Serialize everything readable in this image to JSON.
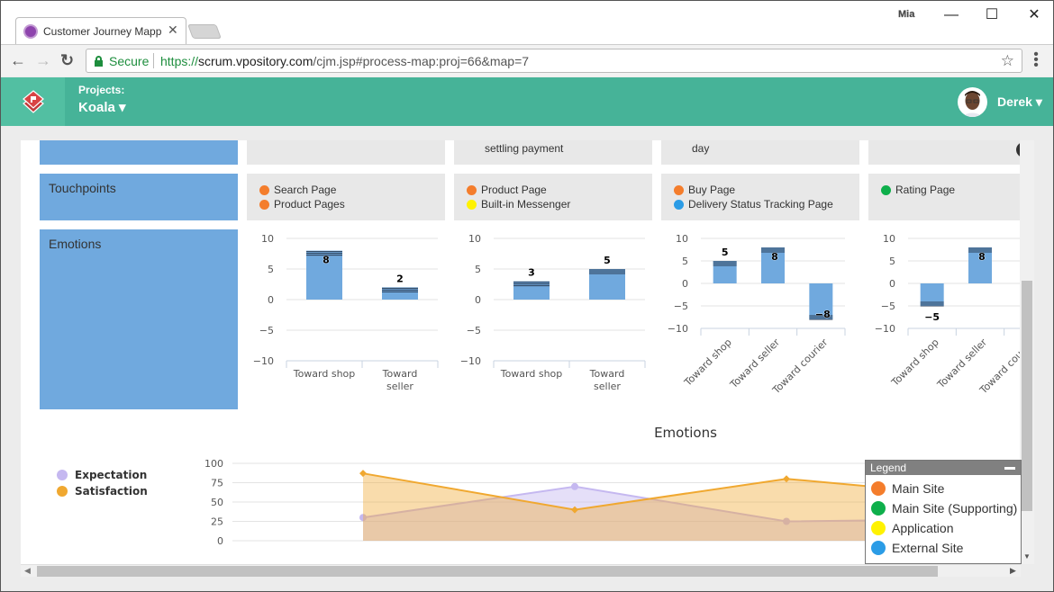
{
  "browser": {
    "tab_title": "Customer Journey Mappi",
    "profile": "Mia",
    "secure_label": "Secure",
    "url_scheme": "https://",
    "url_host": "scrum.vpository.com",
    "url_path": "/cjm.jsp#process-map:proj=66&map=7",
    "icons": {
      "back": "←",
      "forward": "→",
      "reload": "↻",
      "star": "☆",
      "menu": "⋮",
      "close": "✕",
      "minimize": "—",
      "maximize": "☐"
    }
  },
  "app": {
    "projects_label": "Projects:",
    "project_name": "Koala",
    "user_name": "Derek",
    "caret": "▾"
  },
  "map": {
    "stage_texts": [
      "",
      "settling payment",
      "day",
      ""
    ],
    "rows": {
      "touchpoints_label": "Touchpoints",
      "emotions_label": "Emotions"
    },
    "touchpoints": [
      [
        {
          "label": "Search Page",
          "color": "#f47d2c"
        },
        {
          "label": "Product Pages",
          "color": "#f47d2c"
        }
      ],
      [
        {
          "label": "Product Page",
          "color": "#f47d2c"
        },
        {
          "label": "Built-in Messenger",
          "color": "#fff200"
        }
      ],
      [
        {
          "label": "Buy Page",
          "color": "#f47d2c"
        },
        {
          "label": "Delivery Status Tracking Page",
          "color": "#2b9ce6"
        }
      ],
      [
        {
          "label": "Rating Page",
          "color": "#0eaf4b"
        }
      ]
    ]
  },
  "chart_data": [
    {
      "type": "bar",
      "title": "",
      "categories": [
        "Toward shop",
        "Toward seller"
      ],
      "values": [
        8,
        2
      ],
      "ylim": [
        -10,
        10
      ],
      "yticks": [
        "10",
        "5",
        "0",
        "−5",
        "−10"
      ],
      "rotated_labels": false
    },
    {
      "type": "bar",
      "title": "",
      "categories": [
        "Toward shop",
        "Toward seller"
      ],
      "values": [
        3,
        5
      ],
      "ylim": [
        -10,
        10
      ],
      "yticks": [
        "10",
        "5",
        "0",
        "−5",
        "−10"
      ],
      "rotated_labels": false
    },
    {
      "type": "bar",
      "title": "",
      "categories": [
        "Toward shop",
        "Toward seller",
        "Toward courier"
      ],
      "values": [
        5,
        8,
        -8
      ],
      "ylim": [
        -10,
        10
      ],
      "yticks": [
        "10",
        "5",
        "0",
        "−5",
        "−10"
      ],
      "rotated_labels": true
    },
    {
      "type": "bar",
      "title": "",
      "categories": [
        "Toward shop",
        "Toward seller",
        "Toward courier"
      ],
      "values": [
        -5,
        8,
        null
      ],
      "ylim": [
        -10,
        10
      ],
      "yticks": [
        "10",
        "5",
        "0",
        "−5",
        "−10"
      ],
      "rotated_labels": true
    },
    {
      "type": "area",
      "title": "Emotions",
      "ylim": [
        0,
        100
      ],
      "yticks": [
        "100",
        "75",
        "50",
        "25",
        "0"
      ],
      "x": [
        1,
        2,
        3,
        4
      ],
      "series": [
        {
          "name": "Expectation",
          "color": "#c5b8f0",
          "values": [
            30,
            70,
            25,
            28
          ]
        },
        {
          "name": "Satisfaction",
          "color": "#f0a830",
          "values": [
            87,
            40,
            80,
            55
          ]
        }
      ],
      "legend": "left"
    }
  ],
  "legend_panel": {
    "title": "Legend",
    "items": [
      {
        "label": "Main Site",
        "color": "#f47d2c"
      },
      {
        "label": "Main Site (Supporting)",
        "color": "#0eaf4b"
      },
      {
        "label": "Application",
        "color": "#fff200"
      },
      {
        "label": "External Site",
        "color": "#2b9ce6"
      }
    ]
  }
}
